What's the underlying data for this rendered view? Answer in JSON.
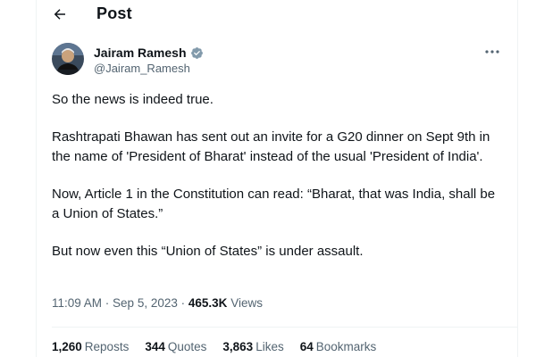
{
  "header": {
    "title": "Post"
  },
  "author": {
    "name": "Jairam Ramesh",
    "handle": "@Jairam_Ramesh",
    "verified": true
  },
  "tweet": {
    "paragraphs": [
      "So the news is indeed true.",
      "Rashtrapati Bhawan has sent out an invite for a G20 dinner on Sept 9th in the name of 'President of Bharat' instead of the usual 'President of India'.",
      "Now, Article 1 in the Constitution can read: “Bharat, that was India, shall be a Union of States.”",
      "But now even this “Union of States” is under assault."
    ]
  },
  "meta": {
    "time": "11:09 AM",
    "date": "Sep 5, 2023",
    "separator": " · ",
    "views_count": "465.3K",
    "views_label": "Views"
  },
  "stats": {
    "reposts_count": "1,260",
    "reposts_label": "Reposts",
    "quotes_count": "344",
    "quotes_label": "Quotes",
    "likes_count": "3,863",
    "likes_label": "Likes",
    "bookmarks_count": "64",
    "bookmarks_label": "Bookmarks"
  },
  "colors": {
    "text_primary": "#0f1419",
    "text_secondary": "#536471",
    "verified_badge": "#829aab",
    "divider": "#eff3f4"
  },
  "icons": {
    "back": "arrow-left-icon",
    "more": "more-horizontal-icon",
    "verified": "verified-badge-icon"
  }
}
